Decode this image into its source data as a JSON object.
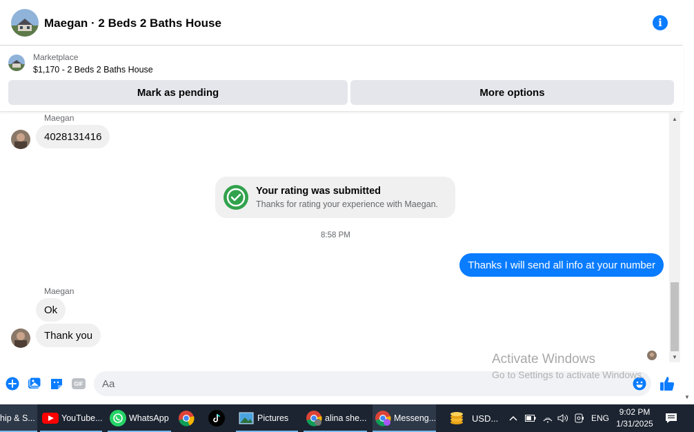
{
  "header": {
    "title": "Maegan · 2 Beds 2 Baths House"
  },
  "marketplace": {
    "label": "Marketplace",
    "listing": "$1,170 - 2 Beds 2 Baths House",
    "mark_pending_label": "Mark as pending",
    "more_options_label": "More options"
  },
  "messages": {
    "sender_1": "Maegan",
    "msg_phone": "4028131416",
    "rating_title": "Your rating was submitted",
    "rating_sub": "Thanks for rating your experience with Maegan.",
    "timestamp": "8:58 PM",
    "msg_out": "Thanks I will send all info at your number",
    "sender_2": "Maegan",
    "msg_ok": "Ok",
    "msg_thanks": "Thank you"
  },
  "composer": {
    "placeholder": "Aa",
    "gif_label": "GIF"
  },
  "watermark": {
    "line1": "Activate Windows",
    "line2": "Go to Settings to activate Windows."
  },
  "taskbar": {
    "items": [
      {
        "label": "hip & S..."
      },
      {
        "label": "YouTube..."
      },
      {
        "label": "WhatsApp"
      },
      {
        "label": ""
      },
      {
        "label": ""
      },
      {
        "label": "Pictures"
      },
      {
        "label": "alina she..."
      },
      {
        "label": "Messeng..."
      },
      {
        "label": "USD..."
      }
    ],
    "lang": "ENG",
    "time": "9:02 PM",
    "date": "1/31/2025"
  },
  "colors": {
    "accent": "#0a7cff",
    "success": "#31a24c",
    "bubble_in": "#f0f0f0",
    "taskbar": "#1c2431"
  }
}
